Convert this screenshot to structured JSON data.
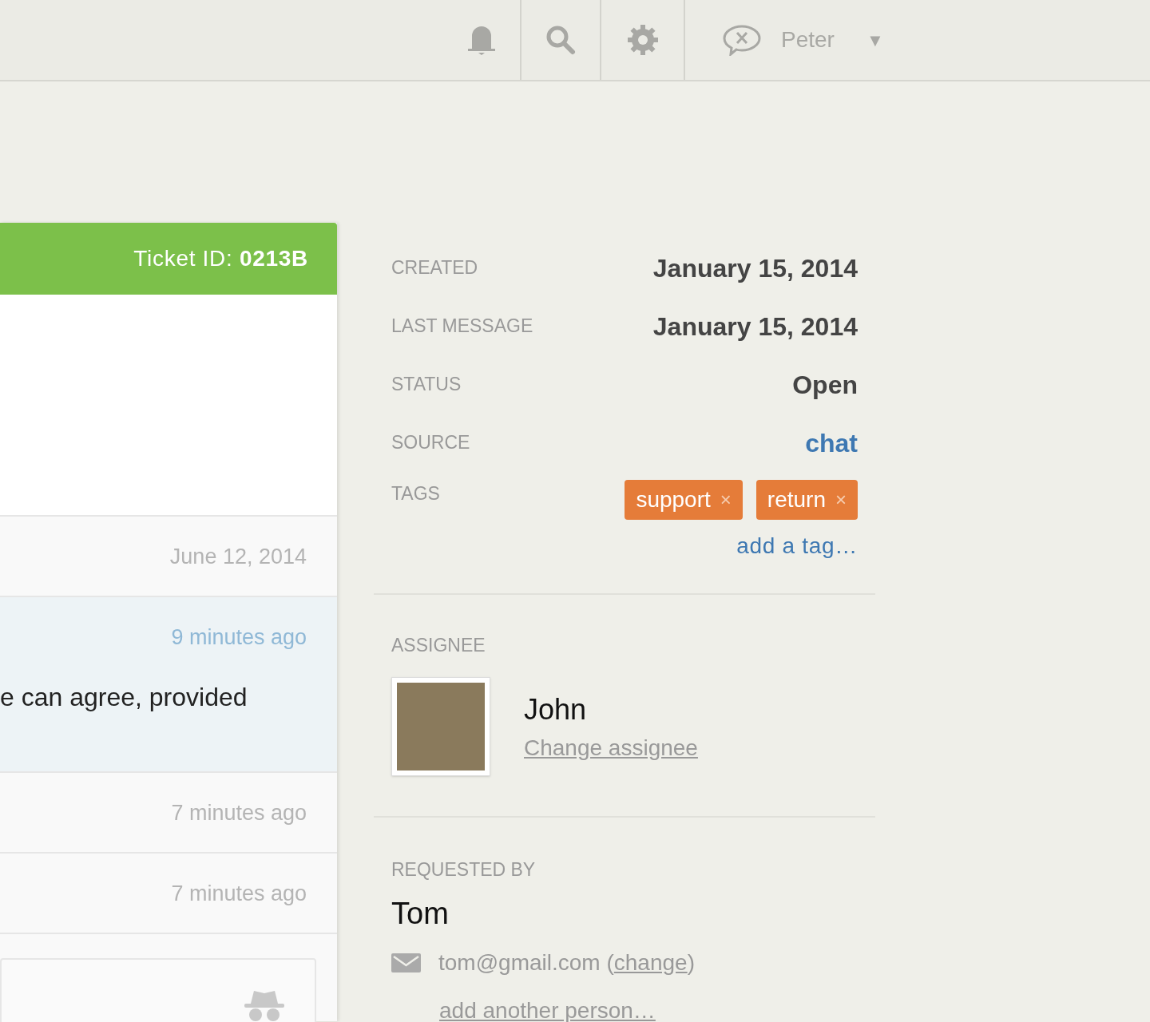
{
  "topbar": {
    "user": "Peter",
    "dropdown_glyph": "▼"
  },
  "ticket": {
    "header": "Ticket ID: **0213B**",
    "messages": [
      {
        "time": "June 12, 2014",
        "selected": false
      },
      {
        "time": "9 minutes ago",
        "text": "e can agree, provided",
        "selected": true
      },
      {
        "time": "7 minutes ago",
        "selected": false
      },
      {
        "time": "7 minutes ago",
        "selected": false
      }
    ]
  },
  "details": [
    {
      "label": "CREATED",
      "value": "January 15, 2014",
      "kind": "text"
    },
    {
      "label": "LAST MESSAGE",
      "value": "January 15, 2014",
      "kind": "text"
    },
    {
      "label": "STATUS",
      "value": "Open",
      "kind": "text"
    },
    {
      "label": "SOURCE",
      "value": "chat",
      "kind": "link"
    }
  ],
  "tags": {
    "label": "TAGS",
    "items": [
      {
        "name": "support",
        "remove": "×"
      },
      {
        "name": "return",
        "remove": "×"
      }
    ],
    "add": "add a tag…"
  },
  "assignee": {
    "label": "ASSIGNEE",
    "name": "John",
    "change": "Change assignee"
  },
  "requested_by": {
    "label": "REQUESTED BY",
    "name": "Tom",
    "email_before": "tom@gmail.com (",
    "change": "change",
    "email_after": ")",
    "add": "add another person…"
  }
}
